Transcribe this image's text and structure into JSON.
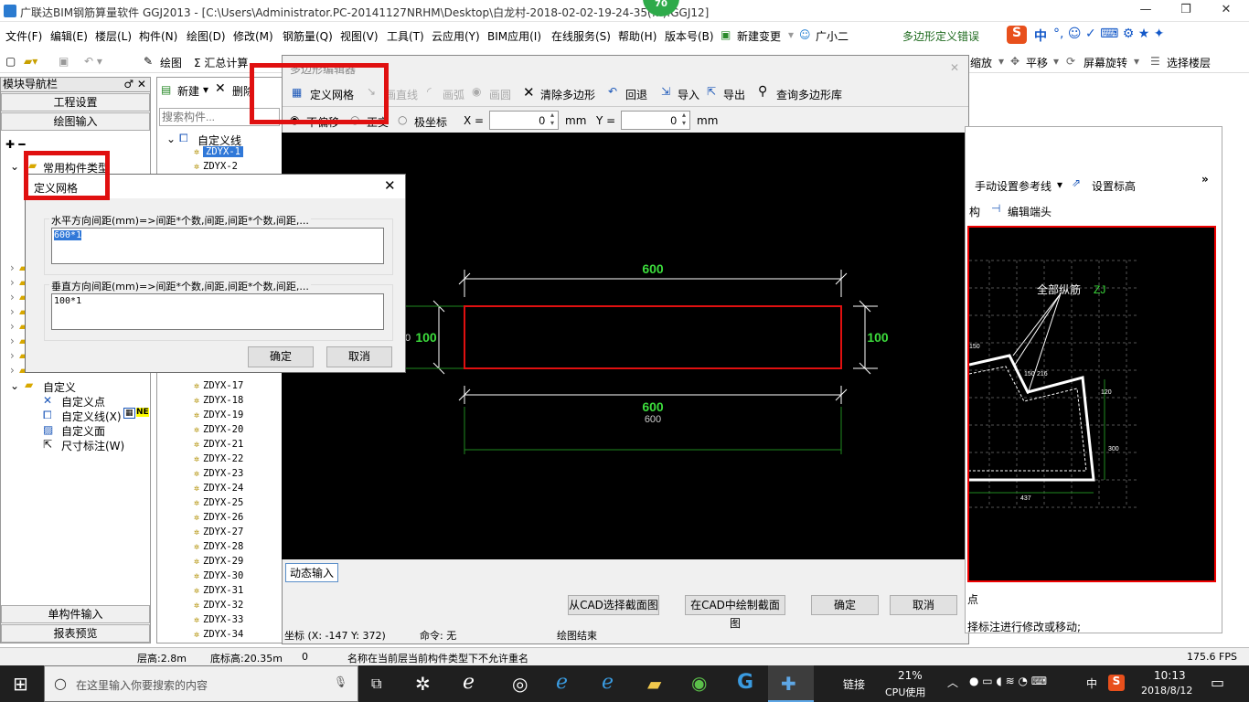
{
  "app": {
    "title": "广联达BIM钢筋算量软件 GGJ2013 - [C:\\Users\\Administrator.PC-20141127NRHM\\Desktop\\白龙村-2018-02-02-19-24-35(…).GGJ12]",
    "badge": "70",
    "min": "—",
    "max": "❒",
    "close": "✕"
  },
  "menu": [
    "文件(F)",
    "编辑(E)",
    "楼层(L)",
    "构件(N)",
    "绘图(D)",
    "修改(M)",
    "钢筋量(Q)",
    "视图(V)",
    "工具(T)",
    "云应用(Y)",
    "BIM应用(I)",
    "在线服务(S)",
    "帮助(H)",
    "版本号(B)",
    "新建变更",
    "广小二"
  ],
  "menu_error": "多边形定义错误",
  "ime": {
    "logo": "S",
    "lang": "中",
    "icons": "°, ☺ ✓ ⌨ ⚙ ★ ✦"
  },
  "toolbar1": {
    "draw": "绘图",
    "sum": "Σ 汇总计算",
    "zoom": "缩放",
    "pan": "平移",
    "rotate": "屏幕旋转",
    "floor": "选择楼层"
  },
  "left_panel": {
    "header": "模块导航栏",
    "pin": "♂ ✕",
    "btn_project": "工程设置",
    "btn_draw": "绘图输入",
    "btn_single": "单构件输入",
    "btn_report": "报表预览",
    "tree_common": "常用构件类型",
    "tree_custom": "自定义",
    "tree_point": "自定义点",
    "tree_line": "自定义线(X)",
    "tree_face": "自定义面",
    "tree_dim": "尺寸标注(W)",
    "new_tag": "NE"
  },
  "comp_panel": {
    "new": "新建",
    "delete": "删除",
    "search_placeholder": "搜索构件...",
    "root": "自定义线",
    "items": [
      "ZDYX-1",
      "ZDYX-2",
      "ZDYX-17",
      "ZDYX-18",
      "ZDYX-19",
      "ZDYX-20",
      "ZDYX-21",
      "ZDYX-22",
      "ZDYX-23",
      "ZDYX-24",
      "ZDYX-25",
      "ZDYX-26",
      "ZDYX-27",
      "ZDYX-28",
      "ZDYX-29",
      "ZDYX-30",
      "ZDYX-31",
      "ZDYX-32",
      "ZDYX-33",
      "ZDYX-34"
    ]
  },
  "editor": {
    "title": "多边形编辑器",
    "define_grid": "定义网格",
    "draw_line": "画直线",
    "draw_arc": "画弧",
    "draw_circle": "画圆",
    "clear": "清除多边形",
    "undo": "回退",
    "import": "导入",
    "export": "导出",
    "query": "查询多边形库",
    "opt_no_offset": "不偏移",
    "opt_ortho": "正交",
    "opt_polar": "极坐标",
    "x_label": "X =",
    "x_value": "0",
    "y_label": "Y =",
    "y_value": "0",
    "unit": "mm",
    "dyn_input": "动态输入",
    "from_cad": "从CAD选择截面图",
    "draw_in_cad": "在CAD中绘制截面图",
    "ok": "确定",
    "cancel": "取消",
    "coord": "坐标 (X: -147 Y: 372)",
    "cmd": "命令: 无",
    "status": "绘图结束"
  },
  "drawing": {
    "dim_top": "600",
    "dim_bottom": "600",
    "dim_bottom_small": "600",
    "dim_left": "100",
    "dim_right": "100",
    "dim_left_cut": "0"
  },
  "grid_dialog": {
    "title": "定义网格",
    "close": "✕",
    "h_label": "水平方向间距(mm)=>间距*个数,间距,间距*个数,间距,...",
    "h_value": "600*1",
    "v_label": "垂直方向间距(mm)=>间距*个数,间距,间距*个数,间距,...",
    "v_value": "100*1",
    "ok": "确定",
    "cancel": "取消"
  },
  "right_panel": {
    "manual_ref": "手动设置参考线",
    "set_elev": "设置标高",
    "struct": "构",
    "edit_end": "编辑端头",
    "all_rebar": "全部纵筋",
    "zj": "ZJ",
    "d150a": "150",
    "d150b": "150",
    "d216": "216",
    "d120": "120",
    "d300": "300",
    "d437": "437",
    "hint": "择标注进行修改或移动;",
    "bottom": "点"
  },
  "statusbar": {
    "floor_h": "层高:2.8m",
    "bottom_h": "底标高:20.35m",
    "zero": "0",
    "msg": "名称在当前层当前构件类型下不允许重名",
    "fps": "175.6 FPS"
  },
  "taskbar": {
    "search": "在这里输入你要搜索的内容",
    "link": "链接",
    "cpu_pct": "21%",
    "cpu_label": "CPU使用",
    "lang": "中",
    "time": "10:13",
    "date": "2018/8/12"
  }
}
